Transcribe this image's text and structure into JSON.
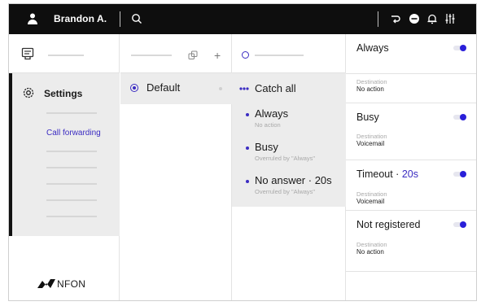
{
  "topbar": {
    "user_name": "Brandon A.",
    "icons": [
      "user-icon",
      "search-icon",
      "call-diversion-icon",
      "do-not-disturb-icon",
      "bell-icon",
      "sliders-icon"
    ]
  },
  "sidebar": {
    "top_icon": "inbox-icon",
    "settings_label": "Settings",
    "call_forwarding_label": "Call forwarding",
    "logo_text": "NFON"
  },
  "profiles": {
    "default_label": "Default"
  },
  "rules": {
    "catch_all_label": "Catch all",
    "items": [
      {
        "title": "Always",
        "subtitle": "No action"
      },
      {
        "title": "Busy",
        "subtitle": "Overruled by \"Always\""
      },
      {
        "title": "No answer · 20s",
        "subtitle": "Overruled by \"Always\""
      }
    ]
  },
  "details": {
    "destination_label": "Destination",
    "cards": [
      {
        "name": "Always",
        "highlight": "",
        "destination": "No action",
        "enabled": true
      },
      {
        "name": "Busy",
        "highlight": "",
        "destination": "Voicemail",
        "enabled": true
      },
      {
        "name": "Timeout · ",
        "highlight": "20s",
        "destination": "Voicemail",
        "enabled": true
      },
      {
        "name": "Not registered",
        "highlight": "",
        "destination": "No action",
        "enabled": true
      }
    ]
  },
  "colors": {
    "accent": "#3b2cc2",
    "toggle_knob": "#2a1fd9",
    "topbar": "#0e0e0e",
    "selected_bg": "#ececec"
  }
}
